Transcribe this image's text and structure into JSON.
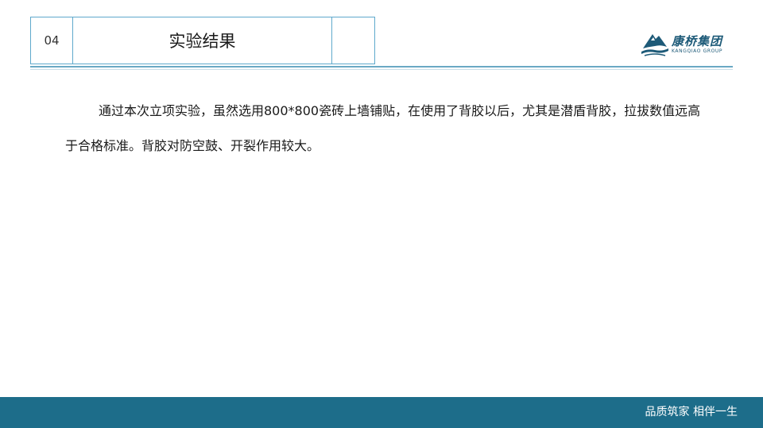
{
  "header": {
    "section_number": "04",
    "title": "实验结果"
  },
  "logo": {
    "name": "康桥集团",
    "subtitle": "KANGQIAO GROUP",
    "color": "#1d5a78"
  },
  "body": {
    "paragraph": "通过本次立项实验，虽然选用800*800瓷砖上墙铺贴，在使用了背胶以后，尤其是潜盾背胶，拉拔数值远高于合格标准。背胶对防空鼓、开裂作用较大。"
  },
  "footer": {
    "slogan": "品质筑家  相伴一生",
    "bar_color": "#1d6d8a"
  }
}
